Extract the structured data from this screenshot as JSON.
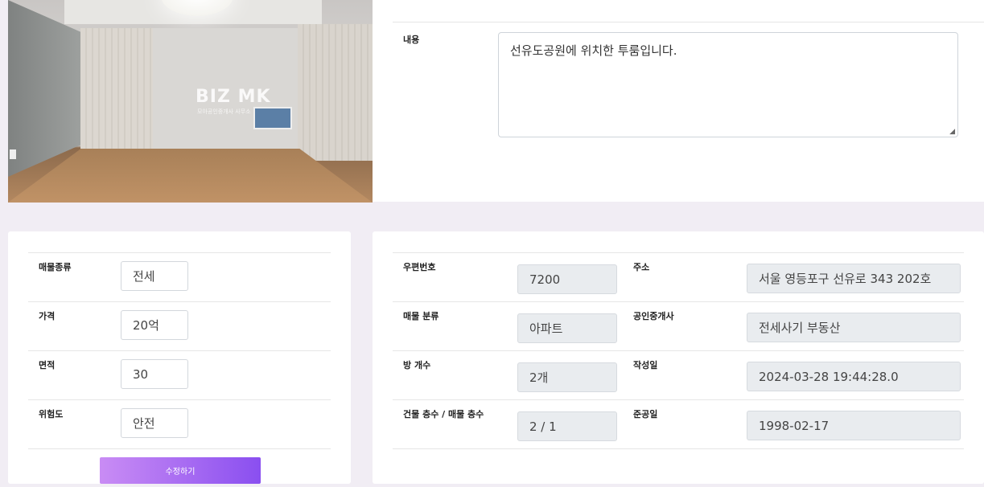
{
  "photo": {
    "watermark_title": "BIZ MK",
    "watermark_sub": "모아공인중개사 사무소"
  },
  "content": {
    "label": "내용",
    "value": "선유도공원에 위치한 투룸입니다."
  },
  "left_form": {
    "fields": [
      {
        "label": "매물종류",
        "value": "전세"
      },
      {
        "label": "가격",
        "value": "20억"
      },
      {
        "label": "면적",
        "value": "30"
      },
      {
        "label": "위험도",
        "value": "안전"
      }
    ],
    "submit_label": "수정하기"
  },
  "right_form": {
    "rows": [
      {
        "label1": "우편번호",
        "value1": "7200",
        "label2": "주소",
        "value2": "서울 영등포구 선유로 343   202호"
      },
      {
        "label1": "매물 분류",
        "value1": "아파트",
        "label2": "공인중개사",
        "value2": "전세사기 부동산"
      },
      {
        "label1": "방 개수",
        "value1": "2개",
        "label2": "작성일",
        "value2": "2024-03-28 19:44:28.0"
      },
      {
        "label1": "건물 층수 / 매물 층수",
        "value1": "2 / 1",
        "label2": "준공일",
        "value2": "1998-02-17"
      }
    ]
  }
}
